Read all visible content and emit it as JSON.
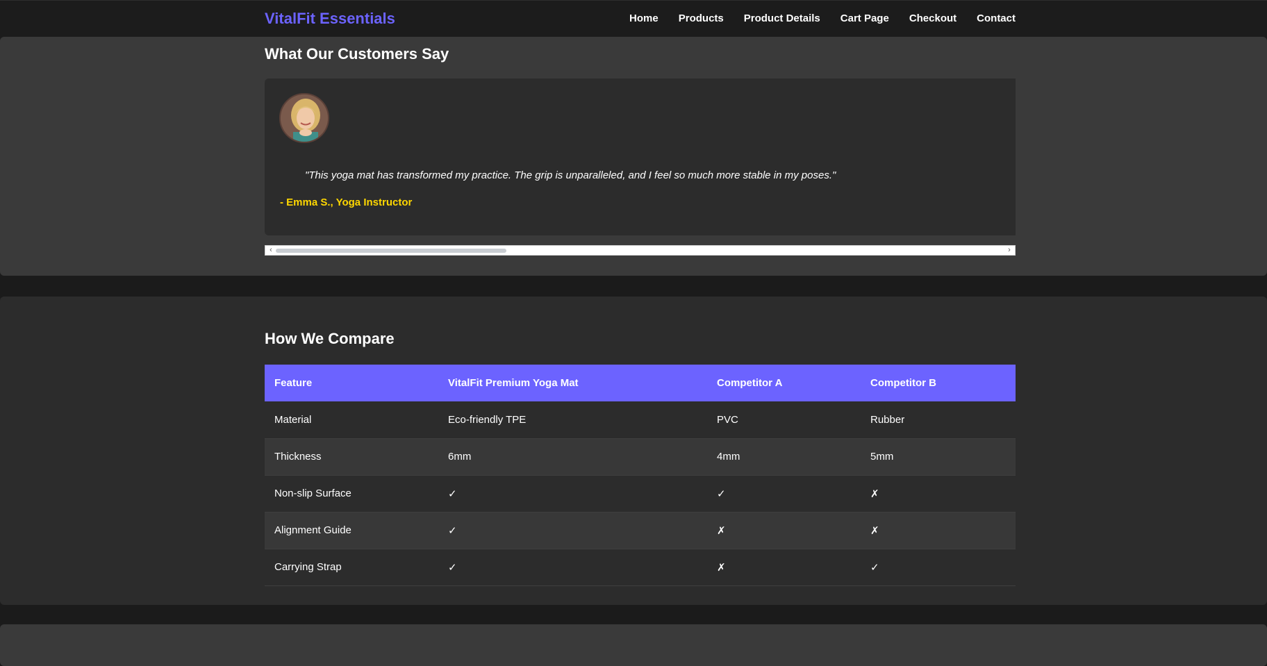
{
  "brand": "VitalFit Essentials",
  "nav": [
    "Home",
    "Products",
    "Product Details",
    "Cart Page",
    "Checkout",
    "Contact"
  ],
  "testimonials": {
    "heading": "What Our Customers Say",
    "quote": "\"This yoga mat has transformed my practice. The grip is unparalleled, and I feel so much more stable in my poses.\"",
    "author": "- Emma S., Yoga Instructor"
  },
  "compare": {
    "heading": "How We Compare",
    "headers": [
      "Feature",
      "VitalFit Premium Yoga Mat",
      "Competitor A",
      "Competitor B"
    ],
    "rows": [
      [
        "Material",
        "Eco-friendly TPE",
        "PVC",
        "Rubber"
      ],
      [
        "Thickness",
        "6mm",
        "4mm",
        "5mm"
      ],
      [
        "Non-slip Surface",
        "✓",
        "✓",
        "✗"
      ],
      [
        "Alignment Guide",
        "✓",
        "✗",
        "✗"
      ],
      [
        "Carrying Strap",
        "✓",
        "✗",
        "✓"
      ]
    ]
  },
  "colors": {
    "accent": "#6c63ff",
    "author": "#ffd700",
    "background": "#1b1b1b",
    "section_light": "#3a3a3a",
    "section_dark": "#2c2c2c"
  }
}
